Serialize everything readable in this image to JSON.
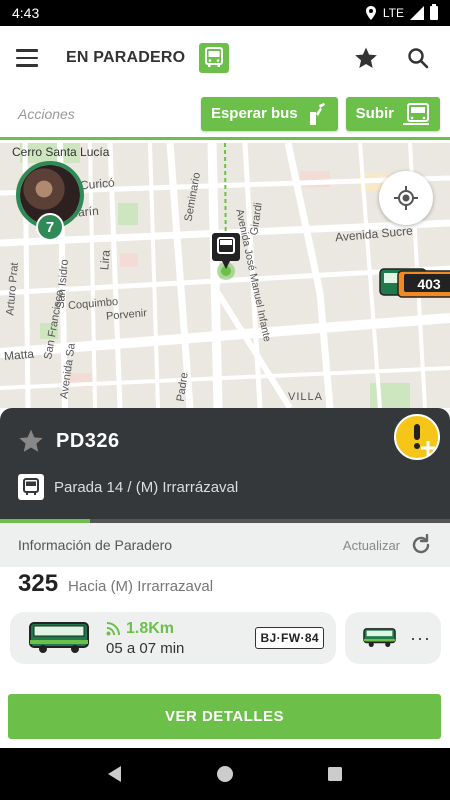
{
  "status_bar": {
    "time": "4:43",
    "network": "LTE"
  },
  "app_bar": {
    "title": "EN PARADERO"
  },
  "actions": {
    "label": "Acciones",
    "wait_bus": "Esperar bus",
    "board": "Subir"
  },
  "map": {
    "labels": {
      "cerro": "Cerro Santa Lucía",
      "curico": "Curicó",
      "marin": "Marín",
      "lira": "Lira",
      "arturo_prat": "Arturo Prat",
      "san_francisco": "San Francisco",
      "san_isidro": "San Isidro",
      "coquimbo": "Coquimbo",
      "porvenir": "Porvenir",
      "matta": "Matta",
      "avenida_matta": "Avenida Sa",
      "seminario": "Seminario",
      "girardi": "Girardi",
      "jose_manuel_infante": "Avenida José Manuel Infante",
      "avenida_sucre": "Avenida Sucre",
      "padre": "Padre",
      "villa": "VILLA"
    },
    "avatar_badge": "7",
    "bus_route_label": "403"
  },
  "stop": {
    "id": "PD326",
    "name": "Parada 14 / (M) Irrarrázaval",
    "progress_fraction": 0.2
  },
  "info": {
    "title": "Información de Paradero",
    "refresh": "Actualizar"
  },
  "route": {
    "number": "325",
    "destination": "Hacia (M) Irrarrazaval",
    "bus": {
      "distance": "1.8Km",
      "eta": "05 a 07 min",
      "plate": "BJ·FW·84"
    },
    "more": "···"
  },
  "details_button": "VER DETALLES",
  "colors": {
    "brand_green": "#6cc04a",
    "dark_card": "#34383b",
    "alert_yellow": "#f5c518",
    "avatar_green": "#2e8b57"
  }
}
